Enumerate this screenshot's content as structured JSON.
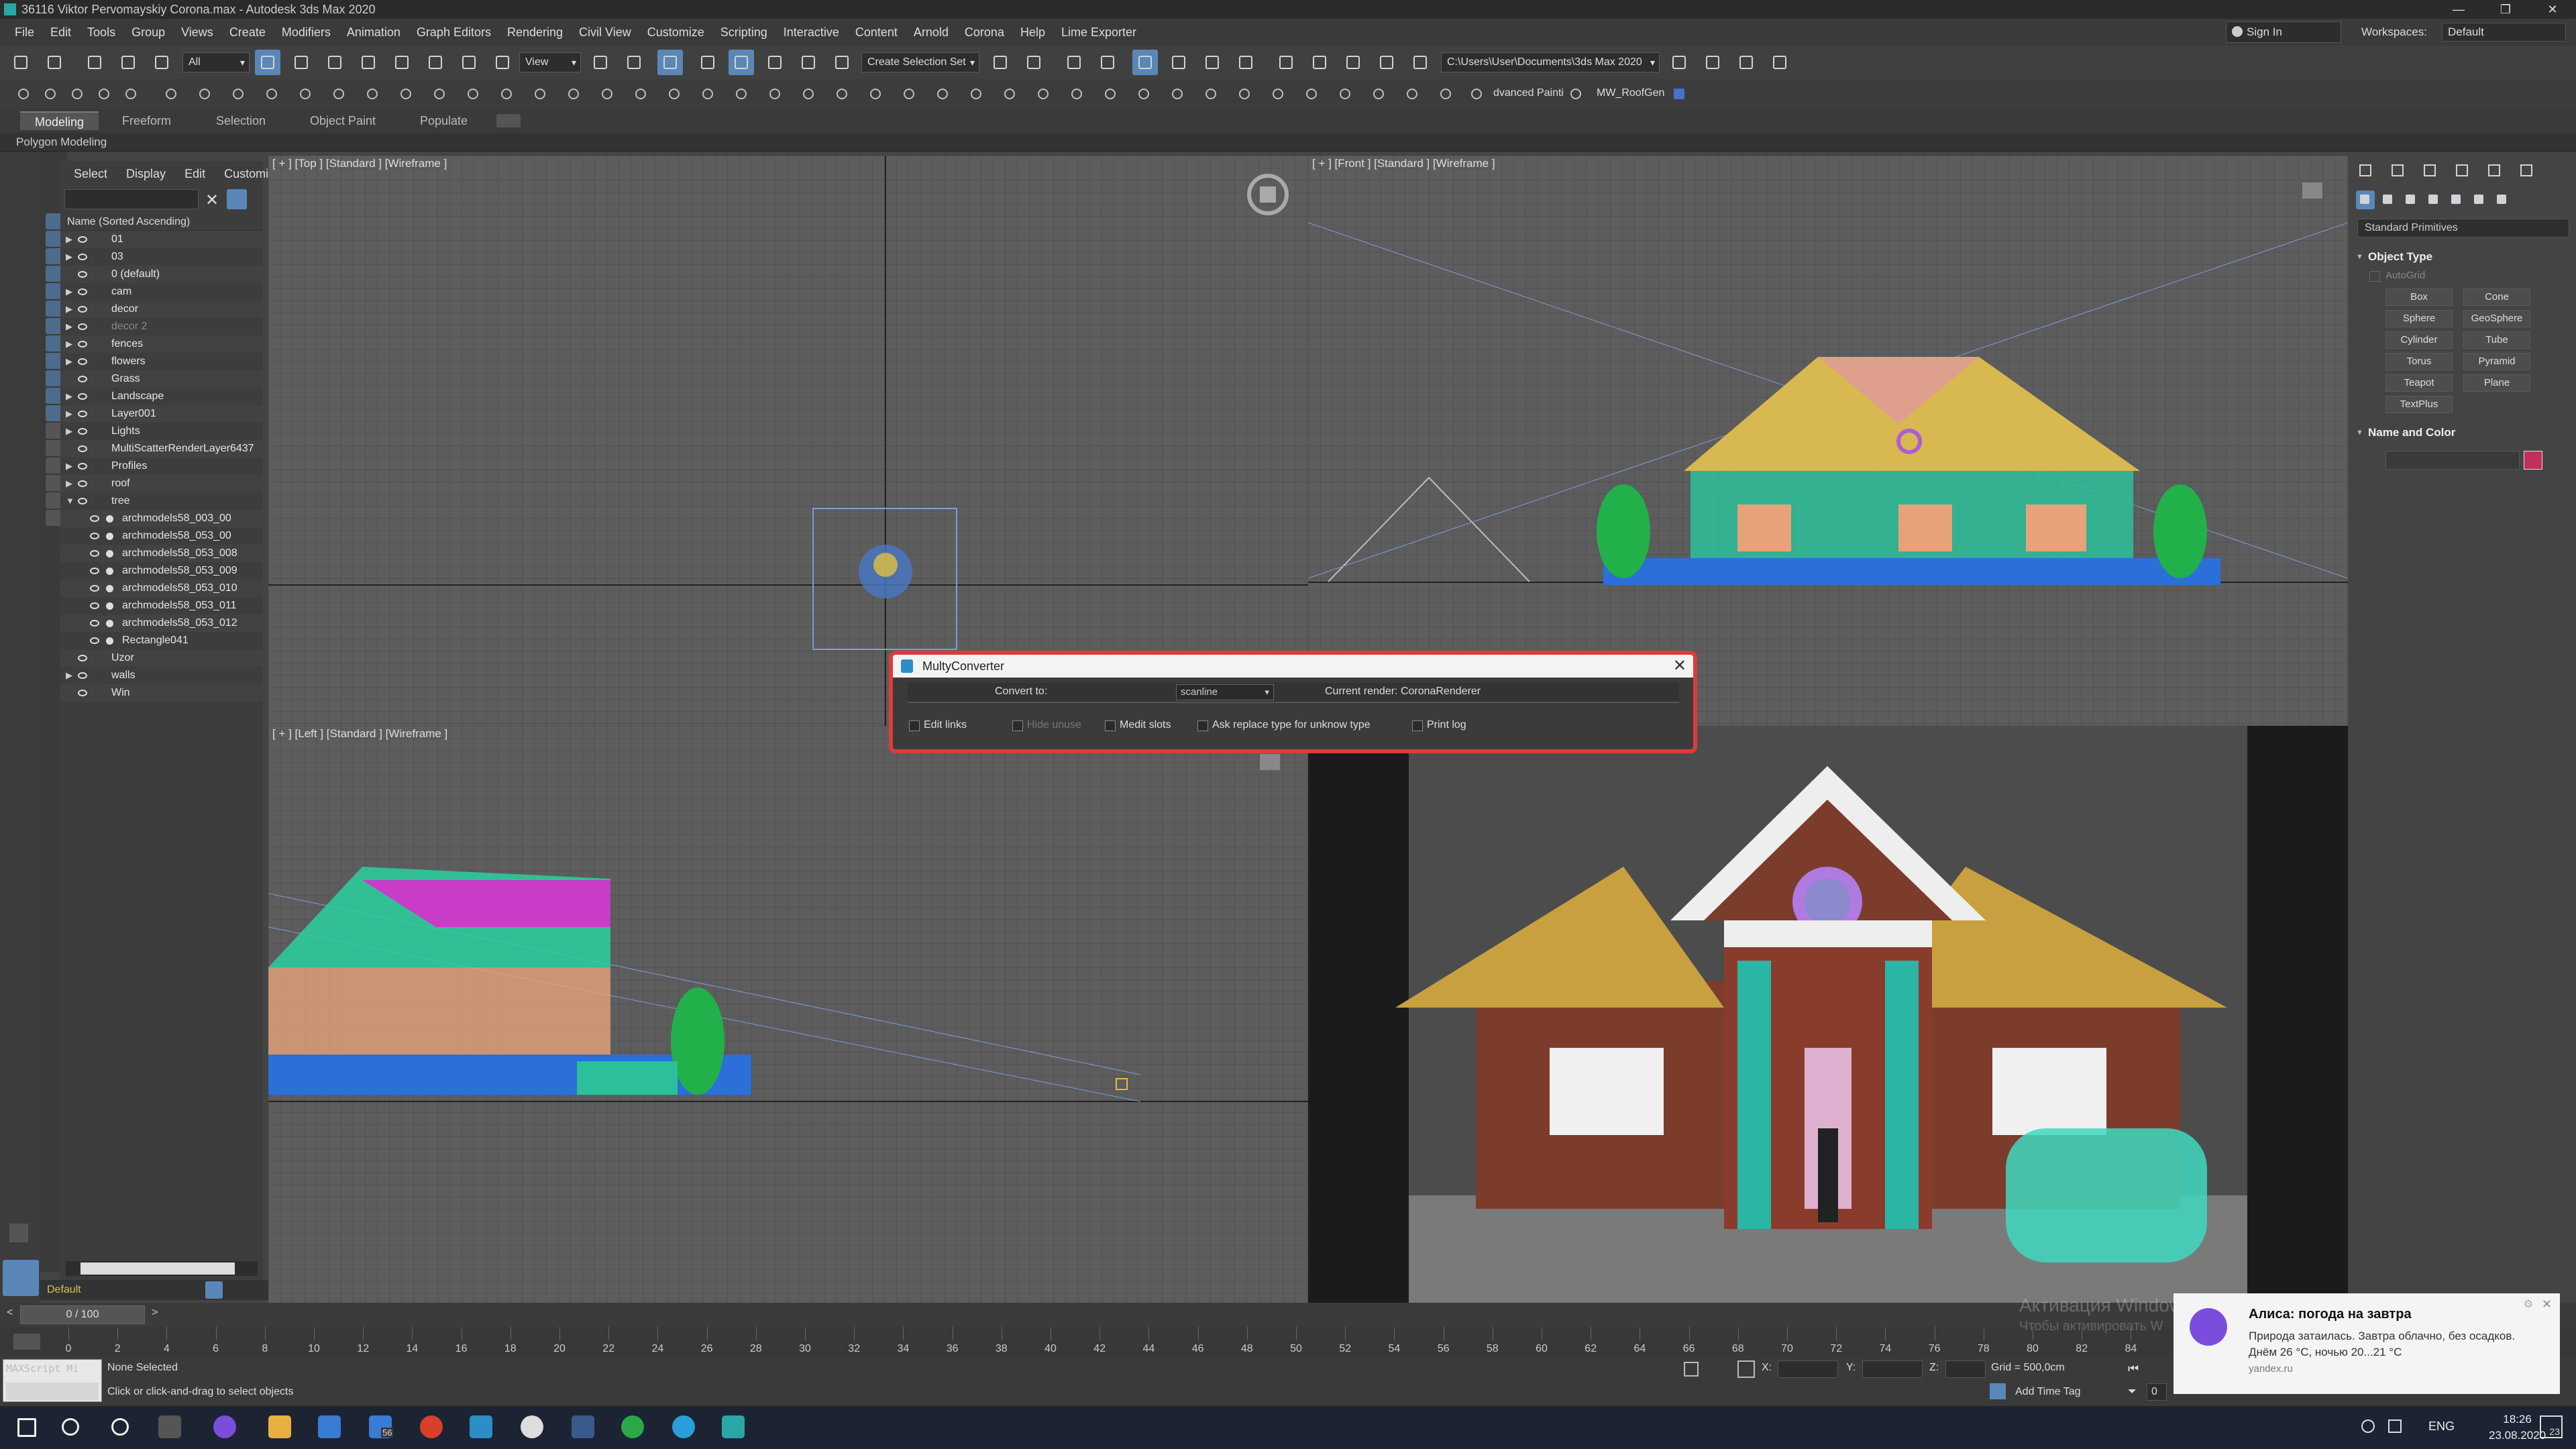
{
  "app": {
    "title": "36116 Viktor Pervomayskiy Corona.max - Autodesk 3ds Max 2020",
    "min": "—",
    "max": "❐",
    "close": "✕"
  },
  "menu": [
    "File",
    "Edit",
    "Tools",
    "Group",
    "Views",
    "Create",
    "Modifiers",
    "Animation",
    "Graph Editors",
    "Rendering",
    "Civil View",
    "Customize",
    "Scripting",
    "Interactive",
    "Content",
    "Arnold",
    "Corona",
    "Help",
    "Lime Exporter"
  ],
  "account": {
    "signin": "Sign In",
    "workspaces_label": "Workspaces:",
    "workspace": "Default"
  },
  "toolbar": {
    "filter": "All",
    "refcoord": "View",
    "selset": "Create Selection Set",
    "project_path": "C:\\Users\\User\\Documents\\3ds Max 2020",
    "plugin1": "dvanced Painti",
    "plugin2": "MW_RoofGen"
  },
  "ribbon": {
    "tabs": [
      "Modeling",
      "Freeform",
      "Selection",
      "Object Paint",
      "Populate"
    ],
    "active": "Modeling",
    "panel": "Polygon Modeling"
  },
  "explorer": {
    "menu": [
      "Select",
      "Display",
      "Edit",
      "Customize"
    ],
    "header": "Name (Sorted Ascending)",
    "clear": "✕",
    "items": [
      {
        "name": "01",
        "expand": "▶"
      },
      {
        "name": "03",
        "expand": "▶"
      },
      {
        "name": "0 (default)",
        "expand": ""
      },
      {
        "name": "cam",
        "expand": "▶"
      },
      {
        "name": "decor",
        "expand": "▶"
      },
      {
        "name": "decor 2",
        "expand": "▶",
        "dim": true
      },
      {
        "name": "fences",
        "expand": "▶"
      },
      {
        "name": "flowers",
        "expand": "▶"
      },
      {
        "name": "Grass",
        "expand": ""
      },
      {
        "name": "Landscape",
        "expand": "▶"
      },
      {
        "name": "Layer001",
        "expand": "▶"
      },
      {
        "name": "Lights",
        "expand": "▶"
      },
      {
        "name": "MultiScatterRenderLayer6437",
        "expand": ""
      },
      {
        "name": "Profiles",
        "expand": "▶"
      },
      {
        "name": "roof",
        "expand": "▶"
      },
      {
        "name": "tree",
        "expand": "▼"
      },
      {
        "name": "archmodels58_003_00",
        "child": true
      },
      {
        "name": "archmodels58_053_00",
        "child": true
      },
      {
        "name": "archmodels58_053_008",
        "child": true
      },
      {
        "name": "archmodels58_053_009",
        "child": true
      },
      {
        "name": "archmodels58_053_010",
        "child": true
      },
      {
        "name": "archmodels58_053_011",
        "child": true
      },
      {
        "name": "archmodels58_053_012",
        "child": true
      },
      {
        "name": "Rectangle041",
        "child": true
      },
      {
        "name": "Uzor",
        "expand": ""
      },
      {
        "name": "walls",
        "expand": "▶"
      },
      {
        "name": "Win",
        "expand": ""
      }
    ],
    "layer": "Default"
  },
  "viewports": {
    "top": "[ + ] [Top ] [Standard ] [Wireframe ]",
    "front": "[ + ] [Front ] [Standard ] [Wireframe ]",
    "left": "[ + ] [Left ] [Standard ] [Wireframe ]"
  },
  "cmdpanel": {
    "category": "Standard Primitives",
    "object_type": "Object Type",
    "autogrid": "AutoGrid",
    "primitives": [
      "Box",
      "Cone",
      "Sphere",
      "GeoSphere",
      "Cylinder",
      "Tube",
      "Torus",
      "Pyramid",
      "Teapot",
      "Plane",
      "TextPlus"
    ],
    "name_color": "Name and Color"
  },
  "timeline": {
    "frame": "0 / 100",
    "prev": "<",
    "next": ">",
    "ticks": [
      "0",
      "2",
      "4",
      "6",
      "8",
      "10",
      "12",
      "14",
      "16",
      "18",
      "20",
      "22",
      "24",
      "26",
      "28",
      "30",
      "32",
      "34",
      "36",
      "38",
      "40",
      "42",
      "44",
      "46",
      "48",
      "50",
      "52",
      "54",
      "56",
      "58",
      "60",
      "62",
      "64",
      "66",
      "68",
      "70",
      "72",
      "74",
      "76",
      "78",
      "80",
      "82",
      "84"
    ]
  },
  "status": {
    "maxscript": "MAXScript Mi",
    "selection": "None Selected",
    "prompt": "Click or click-and-drag to select objects",
    "x": "X:",
    "y": "Y:",
    "z": "Z:",
    "grid": "Grid = 500,0cm",
    "addtime": "Add Time Tag",
    "frame_field": "0"
  },
  "dialog": {
    "title": "MultyConverter",
    "convert_to": "Convert to:",
    "renderer_select": "scanline",
    "current_render": "Current render: CoronaRenderer",
    "options": [
      {
        "label": "Edit links",
        "disabled": false
      },
      {
        "label": "Hide unuse",
        "disabled": true
      },
      {
        "label": "Medit slots",
        "disabled": false
      },
      {
        "label": "Ask replace type for unknow type",
        "disabled": false
      },
      {
        "label": "Print log",
        "disabled": false
      }
    ]
  },
  "activation": {
    "line1": "Активация Windows",
    "line2": "Чтобы активировать W"
  },
  "notification": {
    "title": "Алиса: погода на завтра",
    "body": "Природа затаилась. Завтра облачно, без осадков. Днём 26 °C, ночью 20...21 °C",
    "source": "yandex.ru",
    "close": "✕",
    "gear": "⚙"
  },
  "taskbar": {
    "mail_badge": "56",
    "lang": "ENG",
    "time": "18:26",
    "date": "23.08.2020",
    "notif_count": "23"
  },
  "colors": {
    "accent": "#5b87b8",
    "dialog_outline": "#e03a3a",
    "vp_active": "#d8c25a"
  }
}
